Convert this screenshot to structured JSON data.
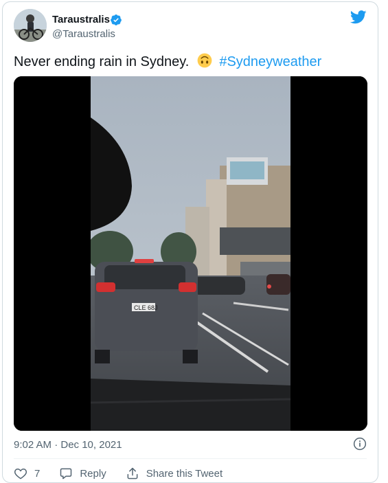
{
  "author": {
    "name": "Taraustralis",
    "handle": "@Taraustralis",
    "verified": true
  },
  "tweet": {
    "text": "Never ending rain in Sydney.",
    "emoji": "upside-down-face-emoji",
    "hashtag": "#Sydneyweather",
    "timestamp": "9:02 AM · Dec 10, 2021"
  },
  "media": {
    "plate_text": "CLE 68J"
  },
  "actions": {
    "like_count": "7",
    "reply_label": "Reply",
    "share_label": "Share this Tweet"
  },
  "colors": {
    "accent": "#1d9bf0",
    "text_primary": "#0f1419",
    "text_secondary": "#536471",
    "verified_badge": "#1d9bf0"
  }
}
